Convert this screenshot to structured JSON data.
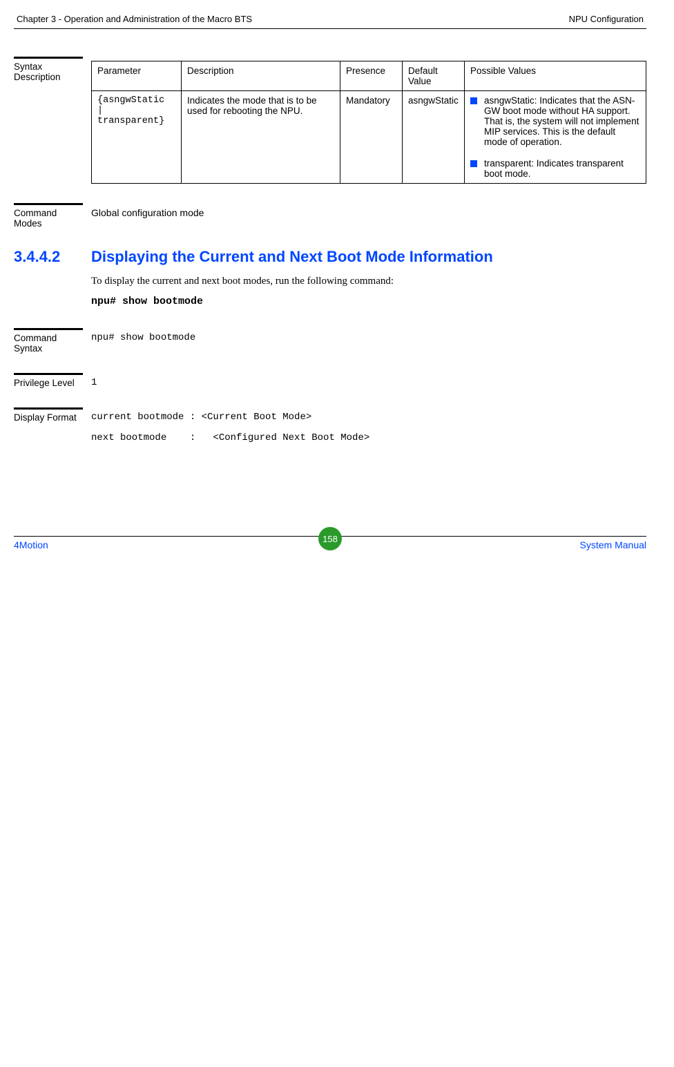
{
  "header": {
    "left": "Chapter 3 - Operation and Administration of the Macro BTS",
    "right": "NPU Configuration"
  },
  "syntax_desc": {
    "label": "Syntax Description",
    "headers": {
      "parameter": "Parameter",
      "description": "Description",
      "presence": "Presence",
      "default_value": "Default Value",
      "possible_values": "Possible Values"
    },
    "row": {
      "parameter": "{asngwStatic | transparent}",
      "description": "Indicates the mode that is to be used for rebooting the NPU.",
      "presence": "Mandatory",
      "default_value": "asngwStatic",
      "possible": {
        "item1": "asngwStatic: Indicates that the ASN-GW boot mode without HA support. That is, the system will not implement MIP services. This is the default mode of operation.",
        "item2": "transparent: Indicates transparent boot mode."
      }
    }
  },
  "command_modes": {
    "label": "Command Modes",
    "value": "Global configuration mode"
  },
  "section": {
    "number": "3.4.4.2",
    "title": "Displaying the Current and Next Boot Mode Information",
    "intro": "To display the current and next boot modes, run the following command:",
    "cmd": "npu# show bootmode"
  },
  "command_syntax": {
    "label": "Command Syntax",
    "value": "npu# show bootmode"
  },
  "privilege_level": {
    "label": "Privilege Level",
    "value": "1"
  },
  "display_format": {
    "label": "Display Format",
    "line1": "current bootmode : <Current Boot Mode>",
    "line2": "next bootmode    :   <Configured Next Boot Mode>"
  },
  "footer": {
    "left": "4Motion",
    "page": "158",
    "right": "System Manual"
  }
}
